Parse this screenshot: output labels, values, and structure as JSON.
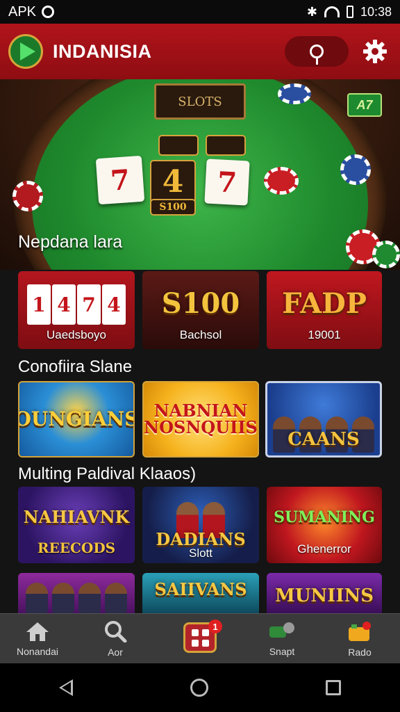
{
  "status_bar": {
    "left_text": "APK",
    "time": "10:38"
  },
  "app_bar": {
    "title": "INDANISIA"
  },
  "hero": {
    "sign_text": "SLOTS",
    "cards": [
      "7",
      "7"
    ],
    "reels": [
      "",
      "",
      "4"
    ],
    "bet_text": "S100",
    "badge_text": "A7",
    "caption": "Nepdana lara"
  },
  "section_1": {
    "tiles": [
      {
        "label": "Uaedsboyo",
        "cards": [
          "1",
          "4",
          "7",
          "4"
        ]
      },
      {
        "label": "Bachsol",
        "art": "S100"
      },
      {
        "label": "19001",
        "art": "FADP"
      }
    ]
  },
  "section_2": {
    "title": "Conofiira Slane",
    "tiles": [
      {
        "art": "OUNGIANS"
      },
      {
        "art": "NABNIAN NOSNQUIIS"
      },
      {
        "art": "CAANS"
      }
    ]
  },
  "section_3": {
    "title": "Multing Paldival Klaaos)",
    "tiles": [
      {
        "art": "NAHIAVNK",
        "label": "REECODS"
      },
      {
        "art": "DADIANS",
        "label": "Slott"
      },
      {
        "art": "SUMANING",
        "label": "Ghenerror"
      },
      {
        "art": ""
      },
      {
        "art": "SAIIVANS"
      },
      {
        "art": "MUNIINS"
      }
    ]
  },
  "bottom_nav": {
    "items": [
      {
        "label": "Nonandai",
        "icon": "home-icon"
      },
      {
        "label": "Aor",
        "icon": "search-icon"
      },
      {
        "label": "",
        "icon": "grid-icon",
        "badge": "1"
      },
      {
        "label": "Snapt",
        "icon": "chat-icon"
      },
      {
        "label": "Rado",
        "icon": "gift-icon"
      }
    ]
  },
  "colors": {
    "app_bar": "#a51219",
    "accent_gold": "#d4a33a",
    "felt_green": "#2a9a37",
    "nav_bg": "#3a3a3a"
  }
}
